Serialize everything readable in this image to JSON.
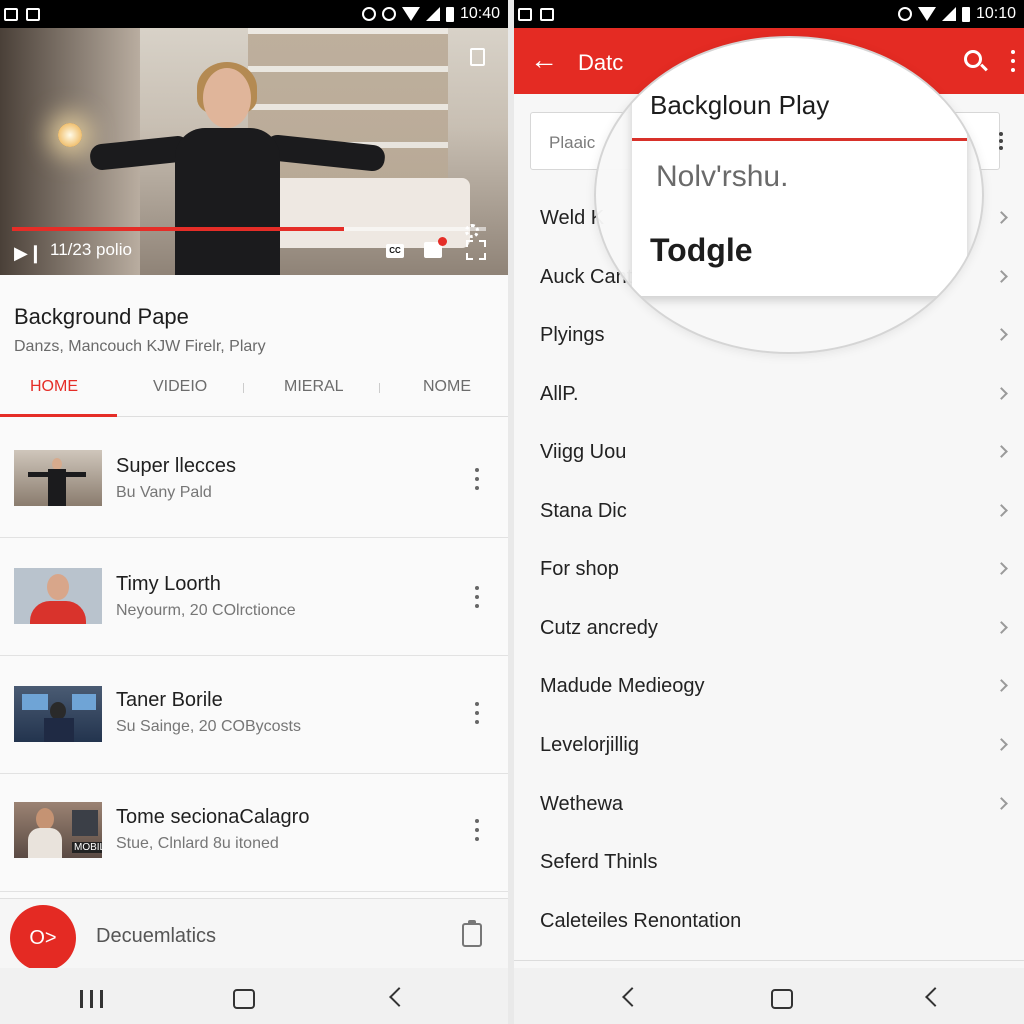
{
  "left": {
    "status": {
      "time": "10:40"
    },
    "player": {
      "time_label": "11/23 polio",
      "progress": 0.7,
      "cc_label": "CC"
    },
    "channel": {
      "title": "Background Pape",
      "subtitle": "Danzs, Mancouch KJW Firelr, Plary"
    },
    "tabs": [
      {
        "label": "HOME",
        "active": true
      },
      {
        "label": "VIDEIO",
        "active": false
      },
      {
        "label": "MIERAL",
        "active": false
      },
      {
        "label": "NOME",
        "active": false
      }
    ],
    "videos": [
      {
        "title": "Super llecces",
        "subtitle": "Bu Vany Pald"
      },
      {
        "title": "Timy Loorth",
        "subtitle": "Neyourm, 20 COlrctionce"
      },
      {
        "title": "Taner Borile",
        "subtitle": "Su Sainge, 20 COBycosts"
      },
      {
        "title": "Tome secionaCalagro",
        "subtitle": "Stue, Clnlard 8u itoned",
        "thumb_badge": "MOBILE"
      }
    ],
    "bottom_bar": {
      "fab_label": "O>",
      "label": "Decuemlatics"
    }
  },
  "right": {
    "status": {
      "time": "10:10"
    },
    "appbar": {
      "title": "Datc",
      "back_glyph": "←"
    },
    "search": {
      "placeholder": "Plaaic"
    },
    "menu_items": [
      {
        "label": "Weld K",
        "chevron": true
      },
      {
        "label": "Auck Cant",
        "chevron": true
      },
      {
        "label": "Plyings",
        "chevron": true
      },
      {
        "label": "AllP.",
        "chevron": true
      },
      {
        "label": "Viigg Uou",
        "chevron": true
      },
      {
        "label": "Stana Dic",
        "chevron": true
      },
      {
        "label": "For shop",
        "chevron": true
      },
      {
        "label": "Cutz ancredy",
        "chevron": true
      },
      {
        "label": "Madude Medieogy",
        "chevron": true
      },
      {
        "label": "Levelorjillig",
        "chevron": true
      },
      {
        "label": "Wethewa",
        "chevron": true
      },
      {
        "label": "Seferd Thinls",
        "chevron": false
      },
      {
        "label": "Caleteiles Renontation",
        "chevron": false
      }
    ],
    "magnifier": {
      "title": "Backgloun Play",
      "option_1": "Nolv'rshu.",
      "option_2": "Todgle"
    }
  },
  "colors": {
    "accent": "#e42b23",
    "progress": "#e52d27"
  }
}
